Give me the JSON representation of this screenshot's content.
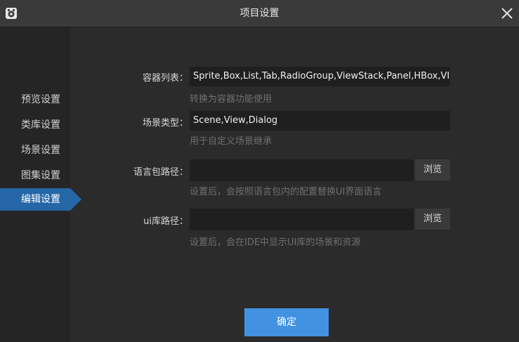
{
  "window": {
    "title": "项目设置"
  },
  "icons": {
    "app": "app-logo-icon",
    "close": "close-icon"
  },
  "sidebar": {
    "items": [
      {
        "label": "预览设置"
      },
      {
        "label": "类库设置"
      },
      {
        "label": "场景设置"
      },
      {
        "label": "图集设置"
      },
      {
        "label": "编辑设置",
        "active": true
      }
    ]
  },
  "form": {
    "container_list": {
      "label": "容器列表：",
      "value": "Sprite,Box,List,Tab,RadioGroup,ViewStack,Panel,HBox,VI",
      "hint": "转换为容器功能使用"
    },
    "scene_type": {
      "label": "场景类型：",
      "value": "Scene,View,Dialog",
      "hint": "用于自定义场景继承"
    },
    "language_path": {
      "label": "语言包路径：",
      "value": "",
      "browse": "浏览",
      "hint": "设置后，会按照语言包内的配置替换UI界面语言"
    },
    "ui_lib_path": {
      "label": "ui库路径：",
      "value": "",
      "browse": "浏览",
      "hint": "设置后，会在IDE中显示UI库的场景和资源"
    }
  },
  "footer": {
    "ok_label": "确定"
  },
  "colors": {
    "accent": "#4192e0",
    "active_nav": "#2566a6",
    "background": "#2b2b2b"
  }
}
